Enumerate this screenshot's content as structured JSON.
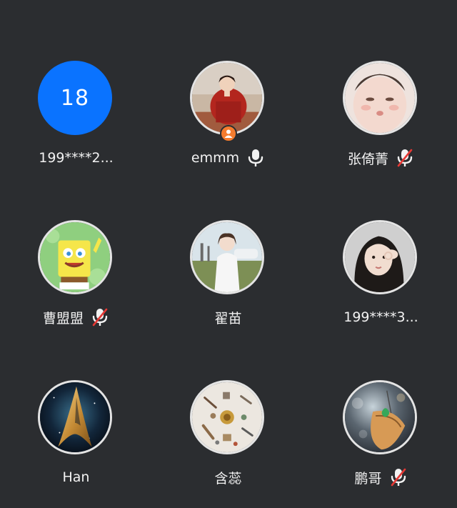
{
  "participants": [
    {
      "name": "199****2...",
      "avatar_text": "18",
      "mic": "none",
      "host": false,
      "avatar": "number-avatar"
    },
    {
      "name": "emmm",
      "mic": "on",
      "host": true,
      "avatar": "photo-avatar"
    },
    {
      "name": "张倚菁",
      "mic": "muted",
      "host": false,
      "avatar": "photo-avatar"
    },
    {
      "name": "曹盟盟",
      "mic": "muted",
      "host": false,
      "avatar": "cartoon-avatar"
    },
    {
      "name": "翟苗",
      "mic": "none",
      "host": false,
      "avatar": "photo-avatar"
    },
    {
      "name": "199****3...",
      "mic": "none",
      "host": false,
      "avatar": "photo-avatar"
    },
    {
      "name": "Han",
      "mic": "none",
      "host": false,
      "avatar": "insignia-avatar"
    },
    {
      "name": "含蕊",
      "mic": "none",
      "host": false,
      "avatar": "illustration-avatar"
    },
    {
      "name": "鹏哥",
      "mic": "muted",
      "host": false,
      "avatar": "photo-avatar"
    }
  ],
  "colors": {
    "background": "#2b2d30",
    "number_avatar": "#0a73ff",
    "host_badge": "#f57c2e",
    "muted_slash": "#e53935",
    "text": "#f2f2f2"
  },
  "icons": {
    "mic_on": "mic-icon",
    "mic_muted": "mic-muted-icon",
    "host": "host-badge-icon"
  }
}
